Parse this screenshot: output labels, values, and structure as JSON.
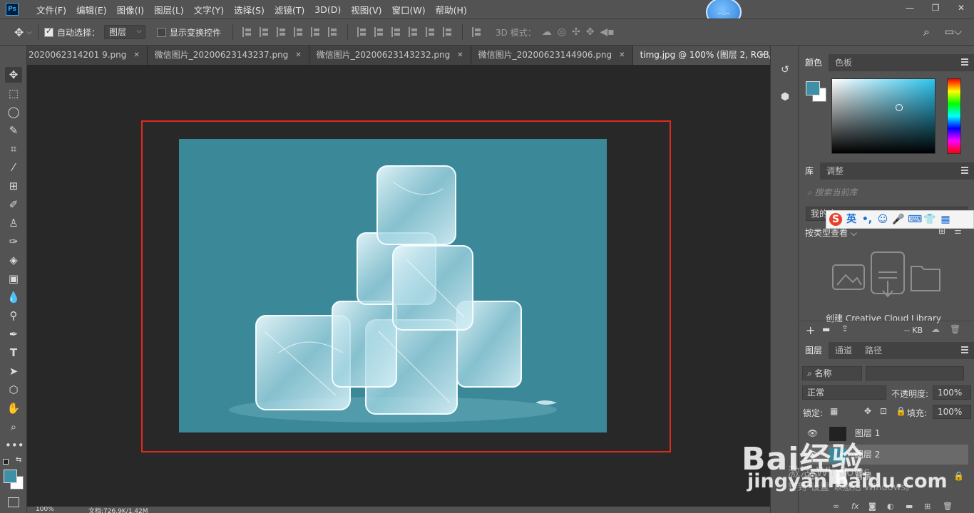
{
  "app": {
    "logo": "Ps",
    "menu": [
      "文件(F)",
      "编辑(E)",
      "图像(I)",
      "图层(L)",
      "文字(Y)",
      "选择(S)",
      "滤镜(T)",
      "3D(D)",
      "视图(V)",
      "窗口(W)",
      "帮助(H)"
    ],
    "clock": "--:--"
  },
  "options": {
    "auto_select_label": "自动选择：",
    "auto_select_target": "图层",
    "transform_label": "显示变换控件",
    "mode3d_label": "3D 模式："
  },
  "tabs": [
    {
      "label": "2020062314201 9.png"
    },
    {
      "label": "微信图片_20200623143237.png"
    },
    {
      "label": "微信图片_20200623143232.png"
    },
    {
      "label": "微信图片_20200623144906.png"
    },
    {
      "label": "timg.jpg @ 100% (图层 2, RGB/8#) *",
      "active": true
    }
  ],
  "status": {
    "zoom": "100%",
    "doc": "文档:726.9K/1.42M"
  },
  "color_panel": {
    "tabs": [
      "颜色",
      "色板"
    ],
    "fg_color": "#3f8fa6",
    "bg_color": "#ffffff"
  },
  "library_panel": {
    "tabs": [
      "库",
      "调整"
    ],
    "search_placeholder": "搜索当前库",
    "library_name": "我的库",
    "view_by": "按类型查看",
    "create_label": "创建 Creative Cloud Library",
    "size_label": "-- KB"
  },
  "layers_panel": {
    "tabs": [
      "图层",
      "通道",
      "路径"
    ],
    "filter_label": "名称",
    "blend_mode": "正常",
    "opacity_label": "不透明度:",
    "opacity_value": "100%",
    "lock_label": "锁定:",
    "fill_label": "填充:",
    "fill_value": "100%",
    "layers": [
      {
        "name": "图层 1"
      },
      {
        "name": "图层 2",
        "selected": true
      },
      {
        "name": "背景"
      }
    ]
  },
  "overlays": {
    "ime_lang": "英",
    "watermark_brand": "Bai经验",
    "watermark_url": "jingyan.baidu.com",
    "activate_title": "激活 Windows",
    "activate_sub": "转到\"设置\"以激活 Windows。"
  }
}
